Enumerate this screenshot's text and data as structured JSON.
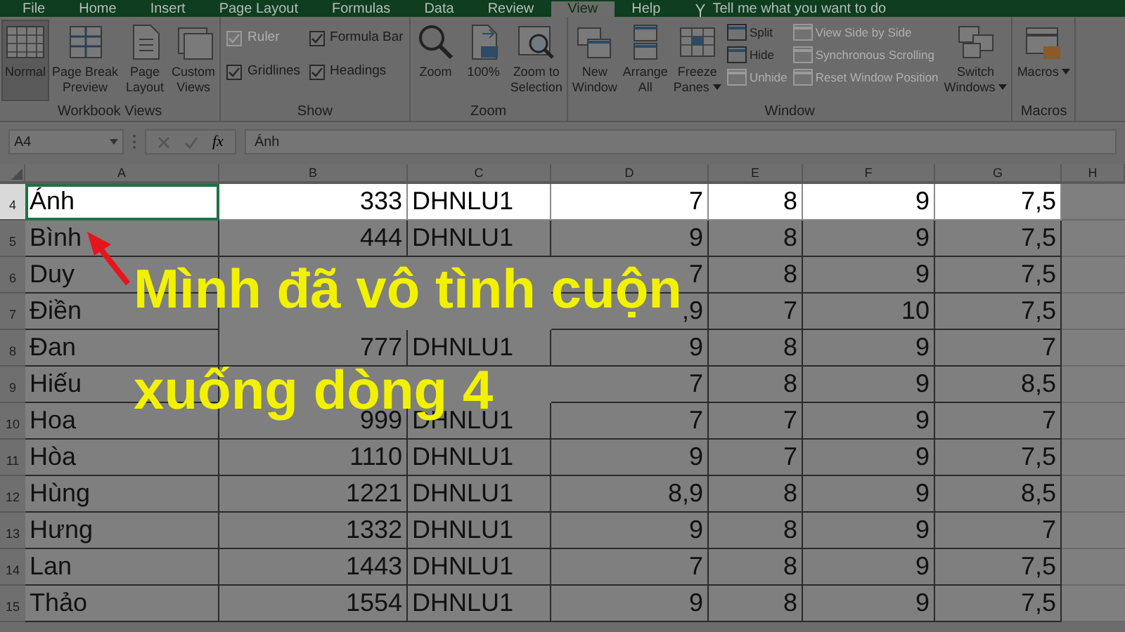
{
  "menu_tabs": [
    {
      "label": "File",
      "selected": false
    },
    {
      "label": "Home",
      "selected": false
    },
    {
      "label": "Insert",
      "selected": false
    },
    {
      "label": "Page Layout",
      "selected": false
    },
    {
      "label": "Formulas",
      "selected": false
    },
    {
      "label": "Data",
      "selected": false
    },
    {
      "label": "Review",
      "selected": false
    },
    {
      "label": "View",
      "selected": true
    },
    {
      "label": "Help",
      "selected": false
    }
  ],
  "tell_me": "Tell me what you want to do",
  "ribbon": [
    {
      "label": "Workbook Views",
      "controls": [
        {
          "kind": "large",
          "lines": [
            "Normal"
          ],
          "selected": true
        },
        {
          "kind": "large",
          "lines": [
            "Page Break",
            "Preview"
          ],
          "selected": false
        },
        {
          "kind": "large",
          "lines": [
            "Page",
            "Layout"
          ],
          "selected": false
        },
        {
          "kind": "large",
          "lines": [
            "Custom",
            "Views"
          ],
          "selected": false
        }
      ]
    },
    {
      "label": "Show",
      "controls": [
        {
          "kind": "checks",
          "items": [
            {
              "label": "Ruler",
              "checked": true,
              "disabled": true
            },
            {
              "label": "Gridlines",
              "checked": true,
              "disabled": false
            }
          ]
        },
        {
          "kind": "checks",
          "items": [
            {
              "label": "Formula Bar",
              "checked": true,
              "disabled": false
            },
            {
              "label": "Headings",
              "checked": true,
              "disabled": false
            }
          ]
        }
      ]
    },
    {
      "label": "Zoom",
      "controls": [
        {
          "kind": "large",
          "lines": [
            "Zoom"
          ]
        },
        {
          "kind": "large",
          "lines": [
            "100%"
          ]
        },
        {
          "kind": "large",
          "lines": [
            "Zoom to",
            "Selection"
          ]
        }
      ]
    },
    {
      "label": "Window",
      "controls": [
        {
          "kind": "large",
          "lines": [
            "New",
            "Window"
          ]
        },
        {
          "kind": "large",
          "lines": [
            "Arrange",
            "All"
          ]
        },
        {
          "kind": "large",
          "lines": [
            "Freeze",
            "Panes"
          ],
          "dropdown": true
        },
        {
          "kind": "stack",
          "items": [
            {
              "label": "Split",
              "disabled": false
            },
            {
              "label": "Hide",
              "disabled": false
            },
            {
              "label": "Unhide",
              "disabled": true
            }
          ]
        },
        {
          "kind": "stack",
          "items": [
            {
              "label": "View Side by Side",
              "disabled": true
            },
            {
              "label": "Synchronous Scrolling",
              "disabled": true
            },
            {
              "label": "Reset Window Position",
              "disabled": true
            }
          ]
        },
        {
          "kind": "large",
          "lines": [
            "Switch",
            "Windows"
          ],
          "dropdown": true
        }
      ]
    },
    {
      "label": "Macros",
      "controls": [
        {
          "kind": "large",
          "lines": [
            "Macros"
          ],
          "dropdown": true
        }
      ]
    }
  ],
  "formula_bar": {
    "name_box": "A4",
    "function_label": "fx",
    "content": "Ánh"
  },
  "columns": [
    "A",
    "B",
    "C",
    "D",
    "E",
    "F",
    "G",
    "H"
  ],
  "rows": [
    {
      "number": "4",
      "highlighted": true,
      "cells": [
        "Ánh",
        "333",
        "DHNLU1",
        "7",
        "8",
        "9",
        "7,5"
      ]
    },
    {
      "number": "5",
      "highlighted": false,
      "cells": [
        "Bình",
        "444",
        "DHNLU1",
        "9",
        "8",
        "9",
        "7,5"
      ]
    },
    {
      "number": "6",
      "highlighted": false,
      "cells": [
        "Duy",
        null,
        null,
        "7",
        "8",
        "9",
        "7,5"
      ]
    },
    {
      "number": "7",
      "highlighted": false,
      "cells": [
        "Điền",
        null,
        null,
        ",9",
        "7",
        "10",
        "7,5"
      ]
    },
    {
      "number": "8",
      "highlighted": false,
      "cells": [
        "Đan",
        "777",
        "DHNLU1",
        "9",
        "8",
        "9",
        "7"
      ]
    },
    {
      "number": "9",
      "highlighted": false,
      "cells": [
        "Hiếu",
        null,
        null,
        "7",
        "8",
        "9",
        "8,5"
      ]
    },
    {
      "number": "10",
      "highlighted": false,
      "cells": [
        "Hoa",
        "999",
        "DHNLU1",
        "7",
        "7",
        "9",
        "7"
      ]
    },
    {
      "number": "11",
      "highlighted": false,
      "cells": [
        "Hòa",
        "1110",
        "DHNLU1",
        "9",
        "7",
        "9",
        "7,5"
      ]
    },
    {
      "number": "12",
      "highlighted": false,
      "cells": [
        "Hùng",
        "1221",
        "DHNLU1",
        "8,9",
        "8",
        "9",
        "8,5"
      ]
    },
    {
      "number": "13",
      "highlighted": false,
      "cells": [
        "Hưng",
        "1332",
        "DHNLU1",
        "9",
        "8",
        "9",
        "7"
      ]
    },
    {
      "number": "14",
      "highlighted": false,
      "cells": [
        "Lan",
        "1443",
        "DHNLU1",
        "7",
        "8",
        "9",
        "7,5"
      ]
    },
    {
      "number": "15",
      "highlighted": false,
      "cells": [
        "Thảo",
        "1554",
        "DHNLU1",
        "9",
        "8",
        "9",
        "7,5"
      ]
    }
  ],
  "annotation": {
    "lines": [
      "Mình đã vô tình cuộn",
      "xuống dòng 4"
    ]
  }
}
